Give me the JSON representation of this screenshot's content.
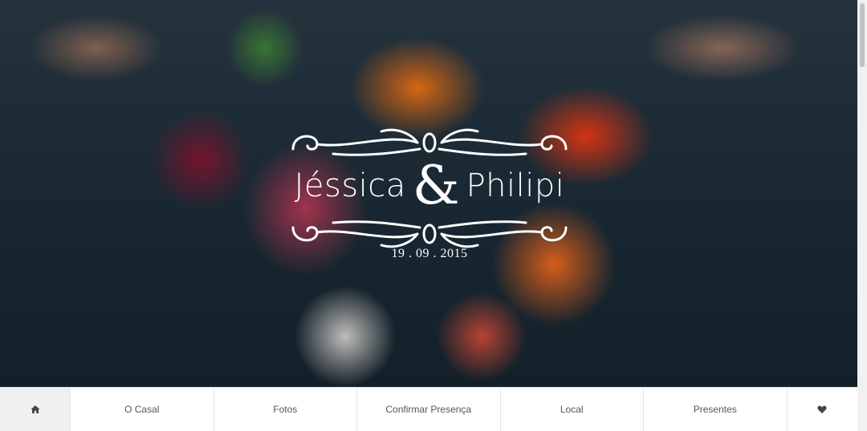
{
  "hero": {
    "name_left": "Jéssica",
    "ampersand": "&",
    "name_right": "Philipi",
    "date": "19 . 09 . 2015"
  },
  "nav": {
    "home_icon": "home-icon",
    "items": [
      {
        "label": "O Casal"
      },
      {
        "label": "Fotos"
      },
      {
        "label": "Confirmar Presença"
      },
      {
        "label": "Local"
      },
      {
        "label": "Presentes"
      }
    ],
    "heart_icon": "heart-icon"
  },
  "colors": {
    "nav_background": "#ffffff",
    "nav_home_background": "#f0f0f0",
    "nav_text": "#555555",
    "logo": "#ffffff"
  }
}
